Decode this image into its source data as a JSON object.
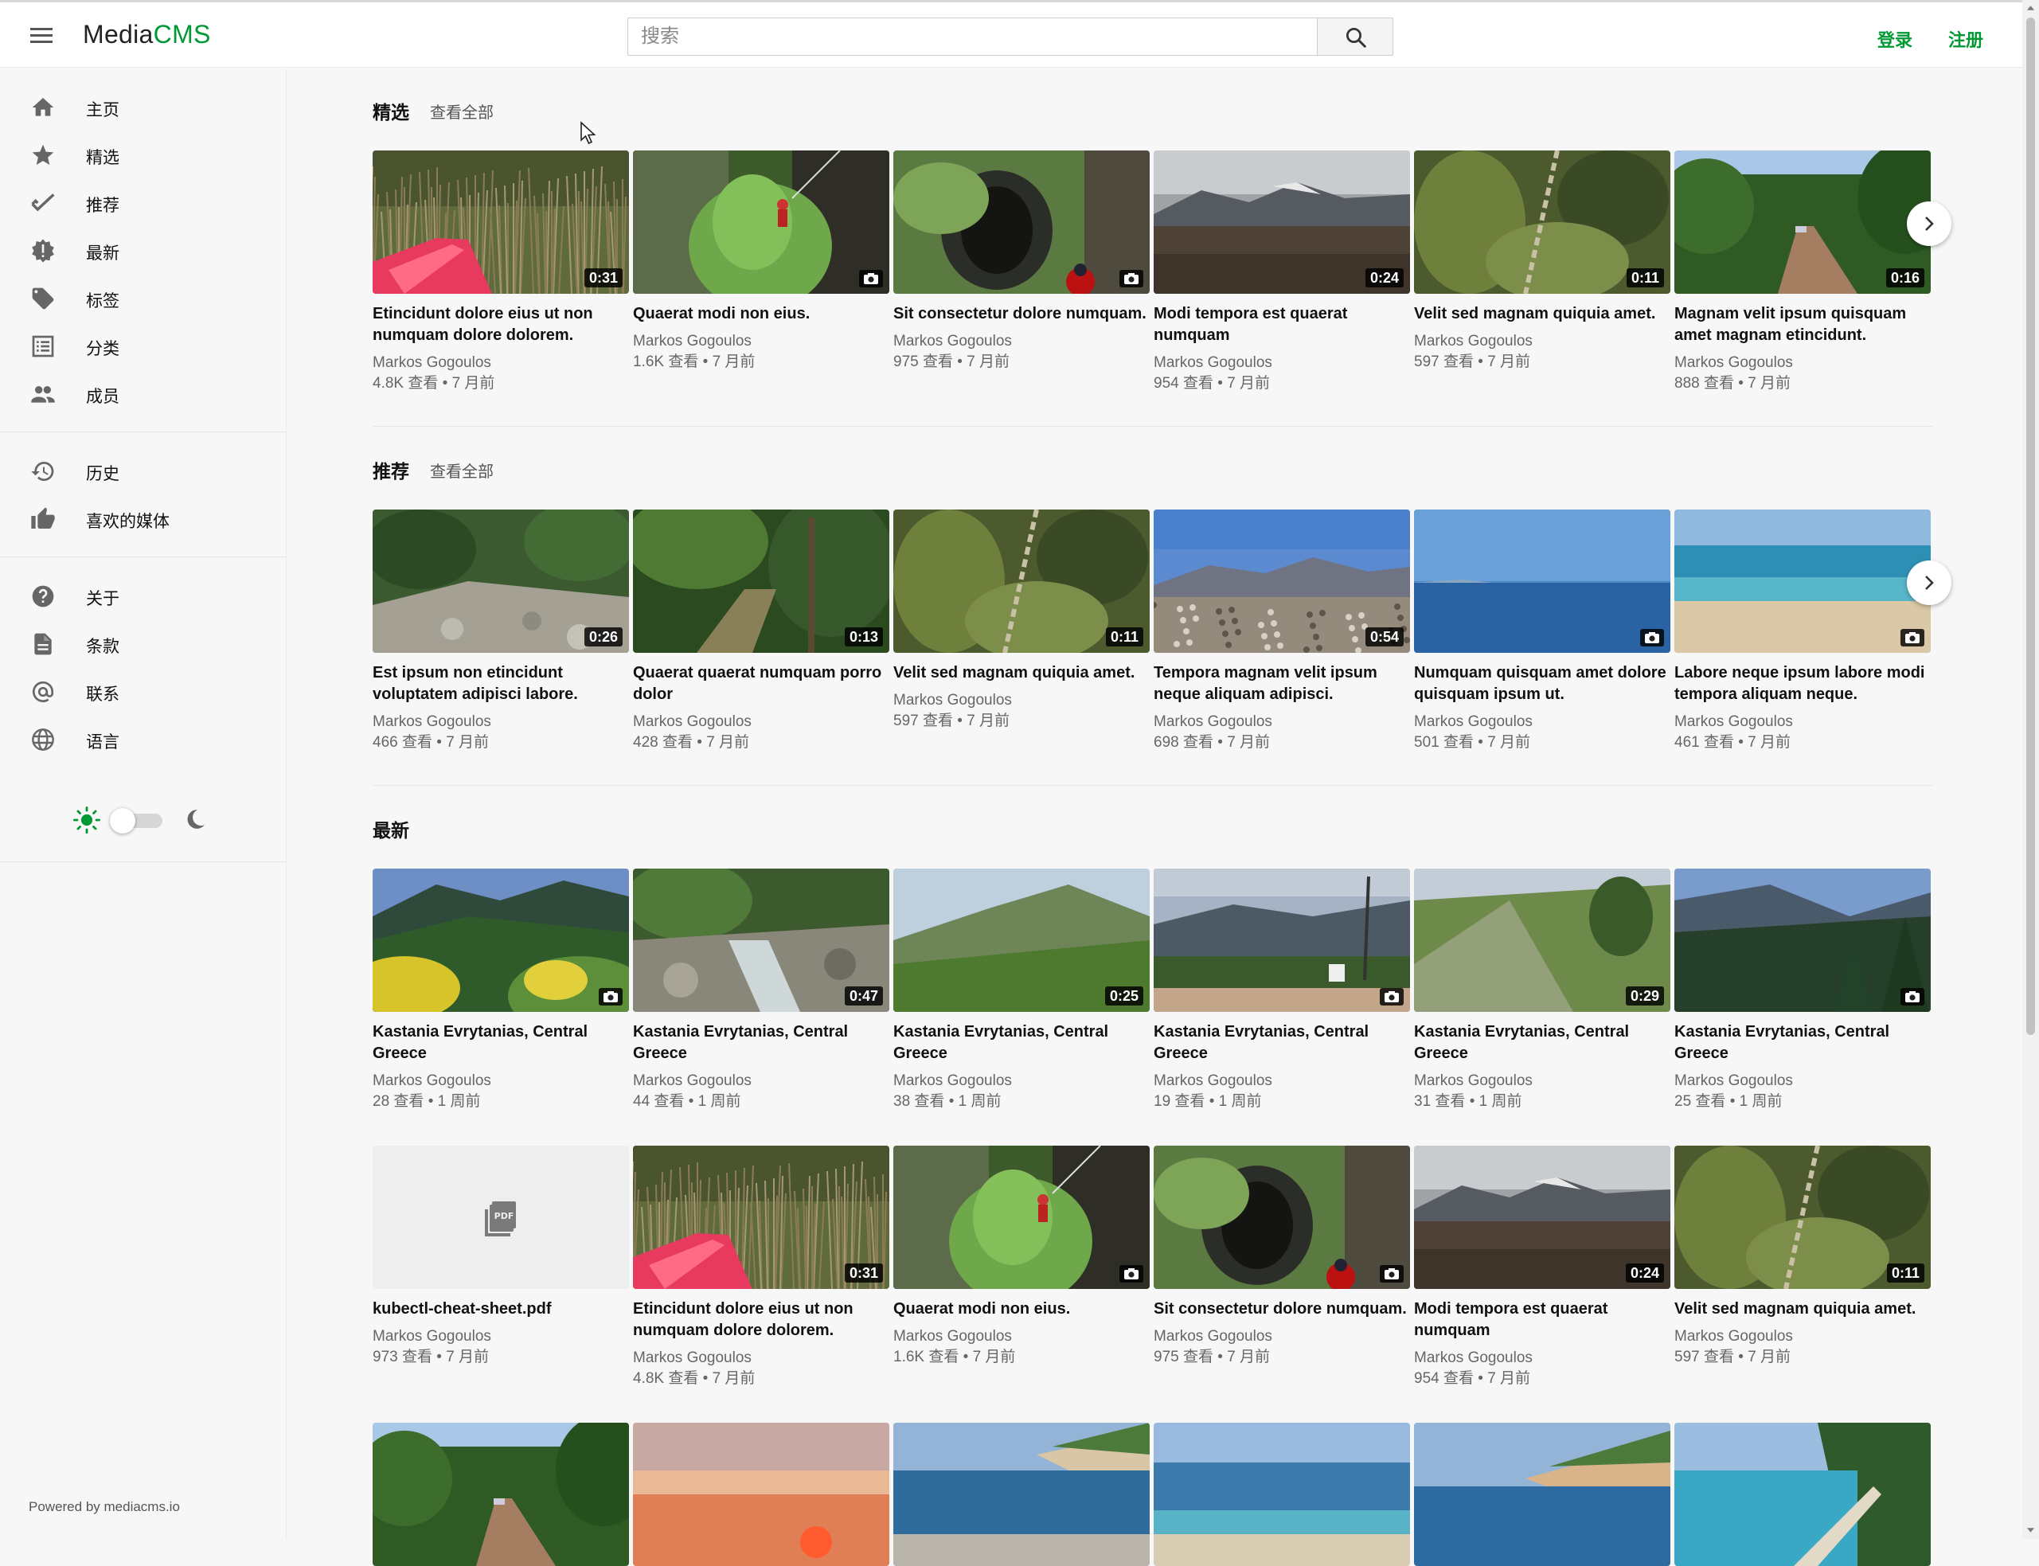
{
  "header": {
    "logo_main": "Media",
    "logo_accent": "CMS",
    "search_placeholder": "搜索",
    "login": "登录",
    "register": "注册"
  },
  "sidebar": {
    "items": [
      {
        "label": "主页",
        "icon": "home-icon"
      },
      {
        "label": "精选",
        "icon": "star-icon"
      },
      {
        "label": "推荐",
        "icon": "check-icon"
      },
      {
        "label": "最新",
        "icon": "new-badge-icon"
      },
      {
        "label": "标签",
        "icon": "tag-icon"
      },
      {
        "label": "分类",
        "icon": "list-icon"
      },
      {
        "label": "成员",
        "icon": "people-icon"
      }
    ],
    "items2": [
      {
        "label": "历史",
        "icon": "history-icon"
      },
      {
        "label": "喜欢的媒体",
        "icon": "thumb-up-icon"
      }
    ],
    "items3": [
      {
        "label": "关于",
        "icon": "help-icon"
      },
      {
        "label": "条款",
        "icon": "document-icon"
      },
      {
        "label": "联系",
        "icon": "at-icon"
      },
      {
        "label": "语言",
        "icon": "globe-icon"
      }
    ],
    "powered_by": "Powered by mediacms.io"
  },
  "sections": {
    "featured": {
      "title": "精选",
      "view_all": "查看全部",
      "cards": [
        {
          "title": "Etincidunt dolore eius ut non numquam dolore dolorem.",
          "author": "Markos Gogoulos",
          "meta": "4.8K 查看 • 7 月前",
          "duration": "0:31",
          "scene": "kayak"
        },
        {
          "title": "Quaerat modi non eius.",
          "author": "Markos Gogoulos",
          "meta": "1.6K 查看 • 7 月前",
          "duration": "",
          "scene": "cliff"
        },
        {
          "title": "Sit consectetur dolore numquam.",
          "author": "Markos Gogoulos",
          "meta": "975 查看 • 7 月前",
          "duration": "",
          "scene": "cave"
        },
        {
          "title": "Modi tempora est quaerat numquam",
          "author": "Markos Gogoulos",
          "meta": "954 查看 • 7 月前",
          "duration": "0:24",
          "scene": "snowmtn"
        },
        {
          "title": "Velit sed magnam quiquia amet.",
          "author": "Markos Gogoulos",
          "meta": "597 查看 • 7 月前",
          "duration": "0:11",
          "scene": "blur"
        },
        {
          "title": "Magnam velit ipsum quisquam amet magnam etincidunt.",
          "author": "Markos Gogoulos",
          "meta": "888 查看 • 7 月前",
          "duration": "0:16",
          "scene": "road"
        }
      ]
    },
    "recommended": {
      "title": "推荐",
      "view_all": "查看全部",
      "cards": [
        {
          "title": "Est ipsum non etincidunt voluptatem adipisci labore.",
          "author": "Markos Gogoulos",
          "meta": "466 查看 • 7 月前",
          "duration": "0:26",
          "scene": "rocks"
        },
        {
          "title": "Quaerat quaerat numquam porro dolor",
          "author": "Markos Gogoulos",
          "meta": "428 查看 • 7 月前",
          "duration": "0:13",
          "scene": "forest"
        },
        {
          "title": "Velit sed magnam quiquia amet.",
          "author": "Markos Gogoulos",
          "meta": "597 查看 • 7 月前",
          "duration": "0:11",
          "scene": "blur"
        },
        {
          "title": "Tempora magnam velit ipsum neque aliquam adipisci.",
          "author": "Markos Gogoulos",
          "meta": "698 查看 • 7 月前",
          "duration": "0:54",
          "scene": "summit"
        },
        {
          "title": "Numquam quisquam amet dolore quisquam ipsum ut.",
          "author": "Markos Gogoulos",
          "meta": "501 查看 • 7 月前",
          "duration": "",
          "scene": "sea"
        },
        {
          "title": "Labore neque ipsum labore modi tempora aliquam neque.",
          "author": "Markos Gogoulos",
          "meta": "461 查看 • 7 月前",
          "duration": "",
          "scene": "beach"
        }
      ]
    },
    "latest": {
      "title": "最新",
      "cards": [
        {
          "title": "Kastania Evrytanias, Central Greece",
          "author": "Markos Gogoulos",
          "meta": "28 查看 • 1 周前",
          "duration": "",
          "scene": "valley"
        },
        {
          "title": "Kastania Evrytanias, Central Greece",
          "author": "Markos Gogoulos",
          "meta": "44 查看 • 1 周前",
          "duration": "0:47",
          "scene": "stream"
        },
        {
          "title": "Kastania Evrytanias, Central Greece",
          "author": "Markos Gogoulos",
          "meta": "38 查看 • 1 周前",
          "duration": "0:25",
          "scene": "meadow"
        },
        {
          "title": "Kastania Evrytanias, Central Greece",
          "author": "Markos Gogoulos",
          "meta": "19 查看 • 1 周前",
          "duration": "",
          "scene": "village"
        },
        {
          "title": "Kastania Evrytanias, Central Greece",
          "author": "Markos Gogoulos",
          "meta": "31 查看 • 1 周前",
          "duration": "0:29",
          "scene": "hillside"
        },
        {
          "title": "Kastania Evrytanias, Central Greece",
          "author": "Markos Gogoulos",
          "meta": "25 查看 • 1 周前",
          "duration": "",
          "scene": "pines"
        }
      ],
      "cards2": [
        {
          "title": "kubectl-cheat-sheet.pdf",
          "author": "Markos Gogoulos",
          "meta": "973 查看 • 7 月前",
          "duration": "",
          "scene": "pdf"
        },
        {
          "title": "Etincidunt dolore eius ut non numquam dolore dolorem.",
          "author": "Markos Gogoulos",
          "meta": "4.8K 查看 • 7 月前",
          "duration": "0:31",
          "scene": "kayak"
        },
        {
          "title": "Quaerat modi non eius.",
          "author": "Markos Gogoulos",
          "meta": "1.6K 查看 • 7 月前",
          "duration": "",
          "scene": "cliff"
        },
        {
          "title": "Sit consectetur dolore numquam.",
          "author": "Markos Gogoulos",
          "meta": "975 查看 • 7 月前",
          "duration": "",
          "scene": "cave"
        },
        {
          "title": "Modi tempora est quaerat numquam",
          "author": "Markos Gogoulos",
          "meta": "954 查看 • 7 月前",
          "duration": "0:24",
          "scene": "snowmtn"
        },
        {
          "title": "Velit sed magnam quiquia amet.",
          "author": "Markos Gogoulos",
          "meta": "597 查看 • 7 月前",
          "duration": "0:11",
          "scene": "blur"
        }
      ],
      "cards3": [
        {
          "scene": "road"
        },
        {
          "scene": "sunset"
        },
        {
          "scene": "coast"
        },
        {
          "scene": "sandsea"
        },
        {
          "scene": "coast2"
        },
        {
          "scene": "bay"
        }
      ]
    }
  },
  "colors": {
    "accent": "#009933",
    "sun": "#009933"
  }
}
